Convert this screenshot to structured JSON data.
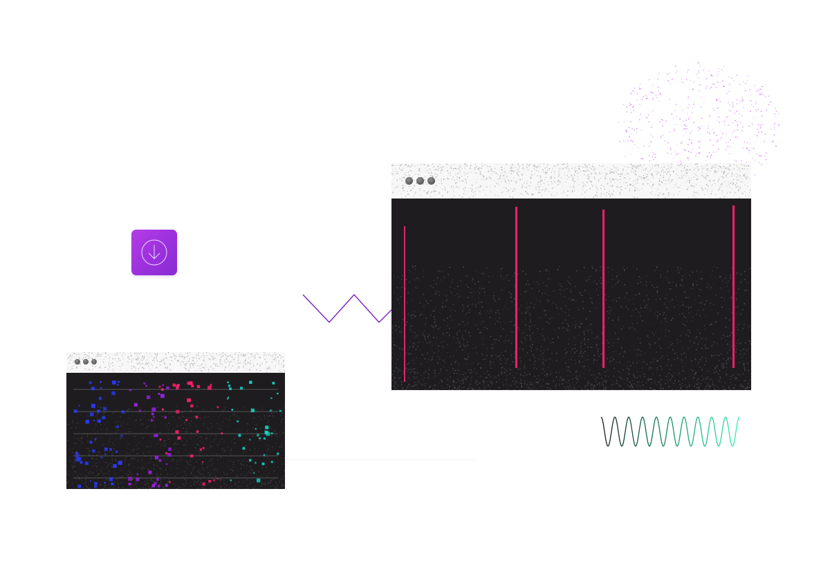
{
  "icons": {
    "download": "download-arrow-circle-icon"
  },
  "colors": {
    "tile_accent": "#a537e0",
    "zigzag": "#7a1fc9",
    "spray": "#d98ef5",
    "sine_start": "#1a1a1a",
    "sine_end": "#2ee8a5",
    "bar_magenta": "#ff1e6e",
    "dark_panel": "#1e1c1f",
    "titlebar": "#f7f7f7",
    "series_blue": "#2b3bff",
    "series_violet": "#9a20e8",
    "series_pink": "#ff1e6e",
    "series_teal": "#12d6c3"
  },
  "windows": [
    {
      "id": "large",
      "controls": [
        "close",
        "minimize",
        "maximize"
      ]
    },
    {
      "id": "small",
      "controls": [
        "close",
        "minimize",
        "maximize"
      ]
    }
  ]
}
